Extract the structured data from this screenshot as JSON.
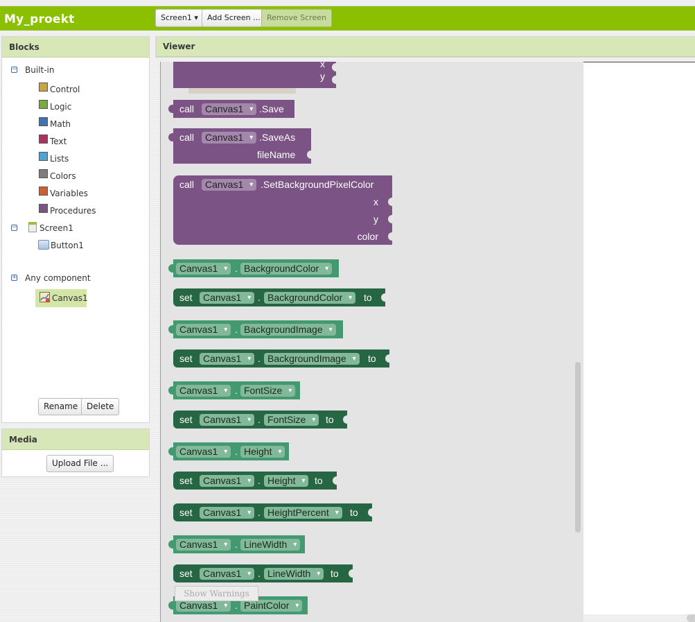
{
  "app": {
    "title": "My_proekt"
  },
  "toolbar": {
    "screen_select": "Screen1",
    "screen_arrow": "▾",
    "add_screen": "Add Screen ...",
    "remove_screen": "Remove Screen"
  },
  "blocks_panel": {
    "title": "Blocks",
    "builtin": {
      "label": "Built-in",
      "items": [
        {
          "label": "Control",
          "color": "#c9a543"
        },
        {
          "label": "Logic",
          "color": "#77ab41"
        },
        {
          "label": "Math",
          "color": "#3f71b5"
        },
        {
          "label": "Text",
          "color": "#b32d5e"
        },
        {
          "label": "Lists",
          "color": "#49a6d4"
        },
        {
          "label": "Colors",
          "color": "#7d7d7d"
        },
        {
          "label": "Variables",
          "color": "#d05f2d"
        },
        {
          "label": "Procedures",
          "color": "#7c5385"
        }
      ]
    },
    "screen": {
      "label": "Screen1",
      "children": [
        "Button1",
        "Canvas1"
      ]
    },
    "any_component": "Any component",
    "rename": "Rename",
    "delete": "Delete"
  },
  "media_panel": {
    "title": "Media",
    "upload": "Upload File ..."
  },
  "viewer": {
    "title": "Viewer",
    "show_warnings": "Show Warnings"
  },
  "blocks": {
    "call": "call",
    "set": "set",
    "to": "to",
    "dot": ".",
    "arrow": "▾",
    "canvas": "Canvas1",
    "partial": {
      "x": "x",
      "y": "y"
    },
    "save": ".Save",
    "saveas": {
      "name": ".SaveAs",
      "arg": "fileName"
    },
    "setbg": {
      "name": ".SetBackgroundPixelColor",
      "args": [
        "x",
        "y",
        "color"
      ]
    },
    "properties": [
      "BackgroundColor",
      "BackgroundImage",
      "FontSize",
      "Height",
      "HeightPercent",
      "LineWidth",
      "PaintColor"
    ]
  }
}
